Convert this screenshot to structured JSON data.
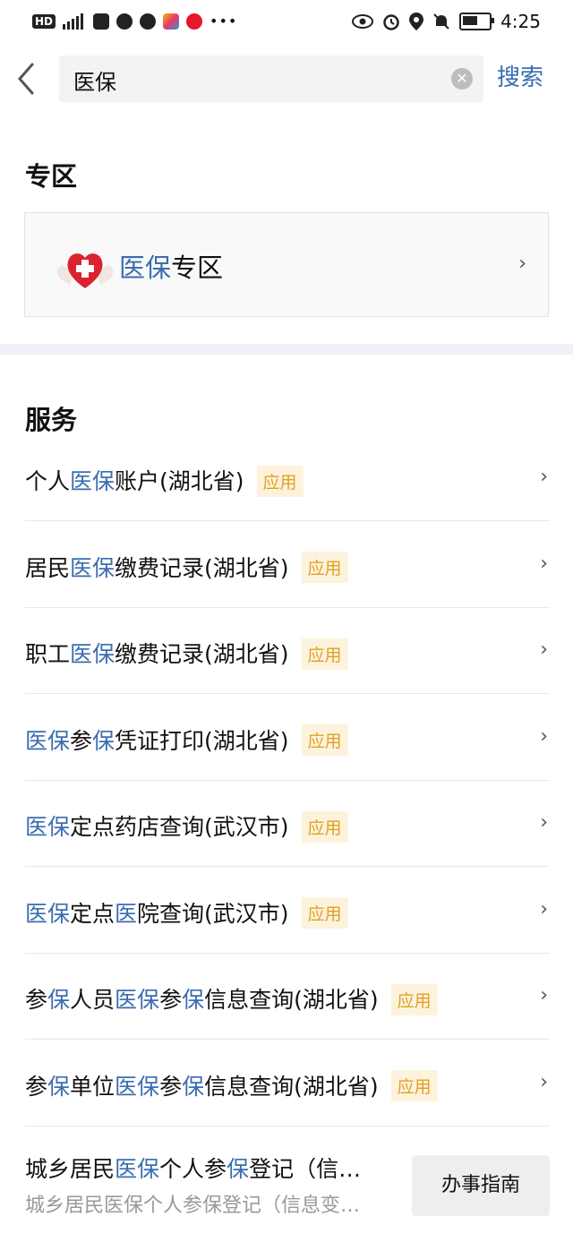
{
  "status_bar": {
    "hd": "HD",
    "time": "4:25",
    "battery_level": 0.6
  },
  "search": {
    "query": "医保",
    "button_label": "搜索"
  },
  "zone": {
    "heading": "专区",
    "title_highlight": "医保",
    "title_rest": "专区"
  },
  "services": {
    "heading": "服务",
    "tag_label": "应用",
    "items": [
      {
        "parts": [
          {
            "t": "个人",
            "hl": false
          },
          {
            "t": "医保",
            "hl": true
          },
          {
            "t": "账户(湖北省)",
            "hl": false
          }
        ]
      },
      {
        "parts": [
          {
            "t": "居民",
            "hl": false
          },
          {
            "t": "医保",
            "hl": true
          },
          {
            "t": "缴费记录(湖北省)",
            "hl": false
          }
        ]
      },
      {
        "parts": [
          {
            "t": "职工",
            "hl": false
          },
          {
            "t": "医保",
            "hl": true
          },
          {
            "t": "缴费记录(湖北省)",
            "hl": false
          }
        ]
      },
      {
        "parts": [
          {
            "t": "医保",
            "hl": true
          },
          {
            "t": "参",
            "hl": false
          },
          {
            "t": "保",
            "hl": true
          },
          {
            "t": "凭证打印(湖北省)",
            "hl": false
          }
        ]
      },
      {
        "parts": [
          {
            "t": "医保",
            "hl": true
          },
          {
            "t": "定点药店查询(武汉市)",
            "hl": false
          }
        ]
      },
      {
        "parts": [
          {
            "t": "医保",
            "hl": true
          },
          {
            "t": "定点",
            "hl": false
          },
          {
            "t": "医",
            "hl": true
          },
          {
            "t": "院查询(武汉市)",
            "hl": false
          }
        ]
      },
      {
        "parts": [
          {
            "t": "参",
            "hl": false
          },
          {
            "t": "保",
            "hl": true
          },
          {
            "t": "人员",
            "hl": false
          },
          {
            "t": "医保",
            "hl": true
          },
          {
            "t": "参",
            "hl": false
          },
          {
            "t": "保",
            "hl": true
          },
          {
            "t": "信息查询(湖北省)",
            "hl": false
          }
        ]
      },
      {
        "parts": [
          {
            "t": "参",
            "hl": false
          },
          {
            "t": "保",
            "hl": true
          },
          {
            "t": "单位",
            "hl": false
          },
          {
            "t": "医保",
            "hl": true
          },
          {
            "t": "参",
            "hl": false
          },
          {
            "t": "保",
            "hl": true
          },
          {
            "t": "信息查询(湖北省)",
            "hl": false
          }
        ]
      }
    ],
    "last": {
      "title_parts": [
        {
          "t": "城乡居民",
          "hl": false
        },
        {
          "t": "医保",
          "hl": true
        },
        {
          "t": "个人参",
          "hl": false
        },
        {
          "t": "保",
          "hl": true
        },
        {
          "t": "登记（信…",
          "hl": false
        }
      ],
      "subtitle": "城乡居民医保个人参保登记（信息变…",
      "button_label": "办事指南"
    }
  },
  "colors": {
    "highlight": "#3b6db0",
    "tag_bg": "#fdf3dc",
    "tag_text": "#e0a024",
    "divider": "#eef1f6"
  }
}
